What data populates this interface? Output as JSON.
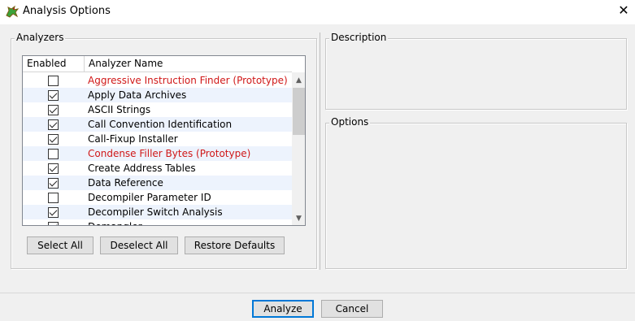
{
  "window": {
    "title": "Analysis Options",
    "close_symbol": "✕"
  },
  "analyzers": {
    "group_label": "Analyzers",
    "columns": [
      "Enabled",
      "Analyzer Name"
    ],
    "rows": [
      {
        "enabled": false,
        "name": "Aggressive Instruction Finder (Prototype)",
        "prototype": true
      },
      {
        "enabled": true,
        "name": "Apply Data Archives",
        "prototype": false
      },
      {
        "enabled": true,
        "name": "ASCII Strings",
        "prototype": false
      },
      {
        "enabled": true,
        "name": "Call Convention Identification",
        "prototype": false
      },
      {
        "enabled": true,
        "name": "Call-Fixup Installer",
        "prototype": false
      },
      {
        "enabled": false,
        "name": "Condense Filler Bytes (Prototype)",
        "prototype": true
      },
      {
        "enabled": true,
        "name": "Create Address Tables",
        "prototype": false
      },
      {
        "enabled": true,
        "name": "Data Reference",
        "prototype": false
      },
      {
        "enabled": false,
        "name": "Decompiler Parameter ID",
        "prototype": false
      },
      {
        "enabled": true,
        "name": "Decompiler Switch Analysis",
        "prototype": false
      },
      {
        "enabled": true,
        "name": "Demangler",
        "prototype": false
      }
    ],
    "buttons": {
      "select_all": "Select All",
      "deselect_all": "Deselect All",
      "restore_defaults": "Restore Defaults"
    }
  },
  "description": {
    "group_label": "Description"
  },
  "options": {
    "group_label": "Options"
  },
  "footer": {
    "analyze": "Analyze",
    "cancel": "Cancel"
  },
  "colors": {
    "prototype_text": "#d01818",
    "alt_row": "#edf3fd",
    "accent": "#0078d7"
  }
}
